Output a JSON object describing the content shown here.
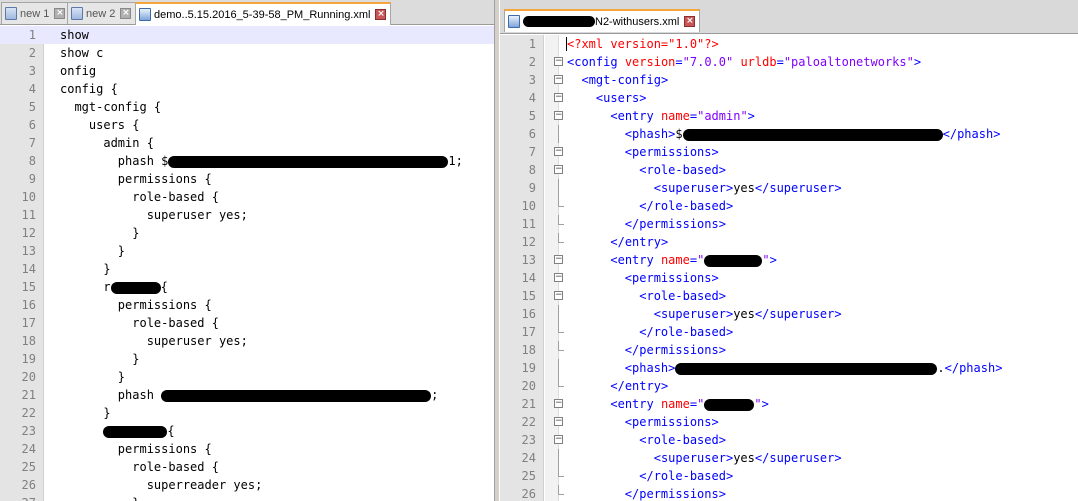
{
  "left": {
    "tabs": [
      {
        "label": "new 1",
        "active": false
      },
      {
        "label": "new 2",
        "active": false
      },
      {
        "label": "demo..5.15.2016_5-39-58_PM_Running.xml",
        "active": true
      }
    ],
    "lines": [
      {
        "n": "1",
        "text": "show"
      },
      {
        "n": "2",
        "text": "show c"
      },
      {
        "n": "3",
        "text": "onfig"
      },
      {
        "n": "4",
        "text": "config {"
      },
      {
        "n": "5",
        "text": "  mgt-config {"
      },
      {
        "n": "6",
        "text": "    users {"
      },
      {
        "n": "7",
        "text": "      admin {"
      },
      {
        "n": "8",
        "text": "        phash $",
        "tail": "1;"
      },
      {
        "n": "9",
        "text": "        permissions {"
      },
      {
        "n": "10",
        "text": "          role-based {"
      },
      {
        "n": "11",
        "text": "            superuser yes;"
      },
      {
        "n": "12",
        "text": "          }"
      },
      {
        "n": "13",
        "text": "        }"
      },
      {
        "n": "14",
        "text": "      }"
      },
      {
        "n": "15",
        "text": "      r",
        "tail": "{"
      },
      {
        "n": "16",
        "text": "        permissions {"
      },
      {
        "n": "17",
        "text": "          role-based {"
      },
      {
        "n": "18",
        "text": "            superuser yes;"
      },
      {
        "n": "19",
        "text": "          }"
      },
      {
        "n": "20",
        "text": "        }"
      },
      {
        "n": "21",
        "text": "        phash ",
        "tail": ";"
      },
      {
        "n": "22",
        "text": "      }"
      },
      {
        "n": "23",
        "text": "      ",
        "tail": "{"
      },
      {
        "n": "24",
        "text": "        permissions {"
      },
      {
        "n": "25",
        "text": "          role-based {"
      },
      {
        "n": "26",
        "text": "            superreader yes;"
      },
      {
        "n": "27",
        "text": "          }"
      }
    ]
  },
  "right": {
    "tabs": [
      {
        "label": "N2-withusers.xml",
        "active": true
      }
    ],
    "lines": [
      {
        "n": "1"
      },
      {
        "n": "2"
      },
      {
        "n": "3"
      },
      {
        "n": "4"
      },
      {
        "n": "5"
      },
      {
        "n": "6"
      },
      {
        "n": "7"
      },
      {
        "n": "8"
      },
      {
        "n": "9"
      },
      {
        "n": "10"
      },
      {
        "n": "11"
      },
      {
        "n": "12"
      },
      {
        "n": "13"
      },
      {
        "n": "14"
      },
      {
        "n": "15"
      },
      {
        "n": "16"
      },
      {
        "n": "17"
      },
      {
        "n": "18"
      },
      {
        "n": "19"
      },
      {
        "n": "20"
      },
      {
        "n": "21"
      },
      {
        "n": "22"
      },
      {
        "n": "23"
      },
      {
        "n": "24"
      },
      {
        "n": "25"
      },
      {
        "n": "26"
      }
    ],
    "xml": {
      "decl": "<?xml version=\"1.0\"?>",
      "config_tag": "config",
      "config_version_attr": "version",
      "config_version_val": "\"7.0.0\"",
      "config_urldb_attr": "urldb",
      "config_urldb_val": "\"paloaltonetworks\"",
      "mgt_config": "mgt-config",
      "users": "users",
      "entry": "entry",
      "name_attr": "name",
      "admin_val": "\"admin\"",
      "phash": "phash",
      "phash_prefix": "$",
      "phash_suffix_19": ".",
      "permissions": "permissions",
      "role_based": "role-based",
      "superuser": "superuser",
      "yes": "yes"
    }
  },
  "colors": {
    "tag": "#0000ff",
    "attr": "#ff0000",
    "value": "#8000ff",
    "active_tab_accent": "#f4a63c",
    "current_line": "#e8e8ff"
  }
}
